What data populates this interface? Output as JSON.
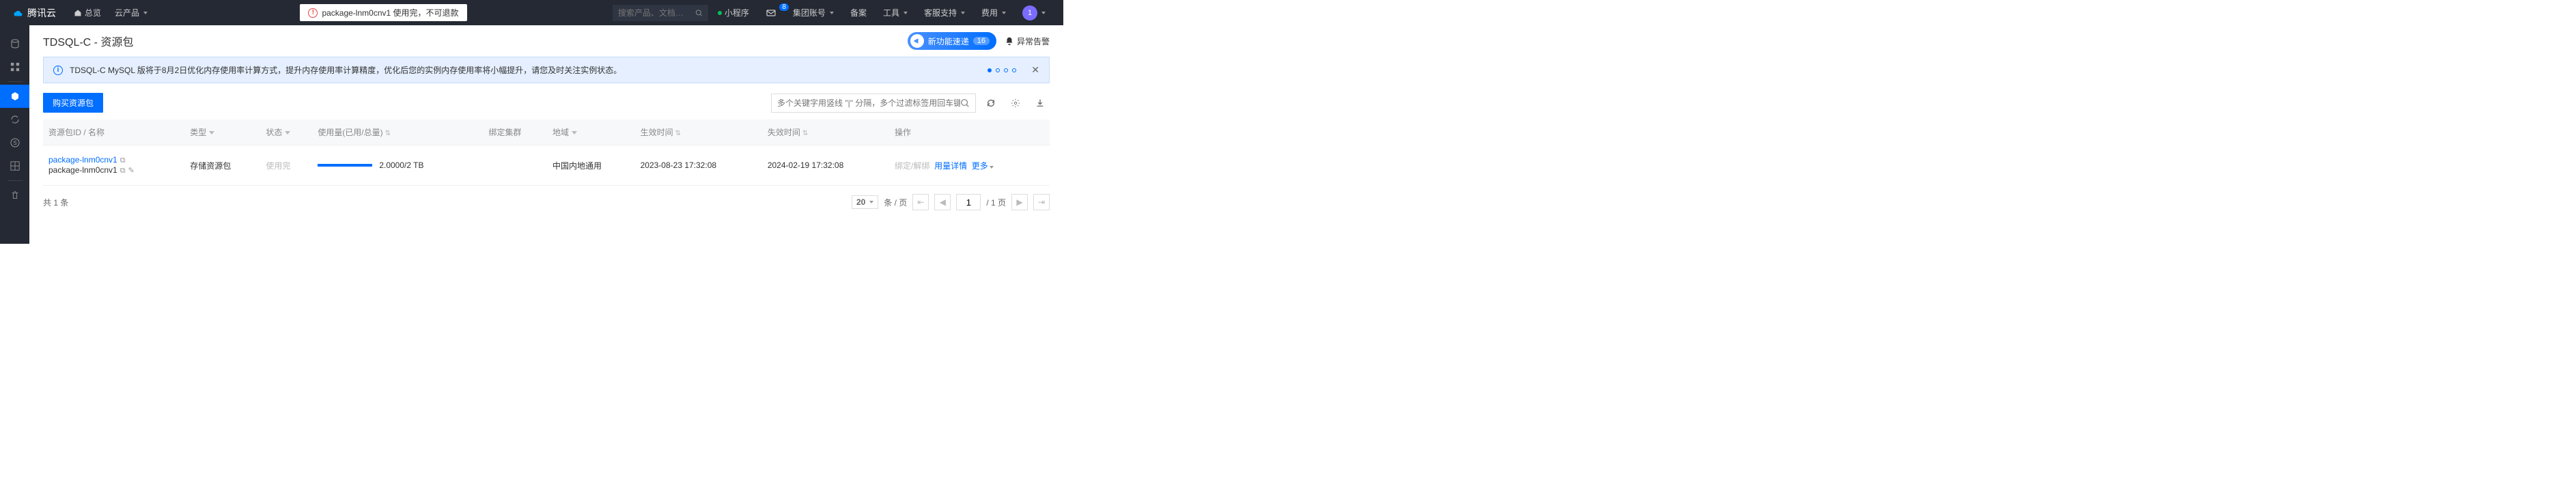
{
  "topbar": {
    "brand": "腾讯云",
    "overview": "总览",
    "products": "云产品",
    "alert_text": "package-lnm0cnv1 使用完，不可退款",
    "search_placeholder": "搜索产品、文档…",
    "mini_program": "小程序",
    "envelope_count": "8",
    "group_account": "集团账号",
    "beian": "备案",
    "tools": "工具",
    "support": "客服支持",
    "fees": "费用",
    "avatar_initial": "1"
  },
  "page": {
    "title": "TDSQL-C - 资源包",
    "new_feature": "新功能速递",
    "new_feature_count": "16",
    "alarm": "异常告警"
  },
  "banner": {
    "text": "TDSQL-C MySQL 版将于8月2日优化内存使用率计算方式，提升内存使用率计算精度，优化后您的实例内存使用率将小幅提升，请您及时关注实例状态。"
  },
  "toolbar": {
    "buy_button": "购买资源包",
    "filter_placeholder": "多个关键字用竖线 \"|\" 分隔，多个过滤标签用回车键分隔"
  },
  "columns": {
    "id_name": "资源包ID / 名称",
    "type": "类型",
    "status": "状态",
    "usage": "使用量(已用/总量)",
    "cluster": "绑定集群",
    "region": "地域",
    "effective": "生效时间",
    "expire": "失效时间",
    "action": "操作"
  },
  "row": {
    "id": "package-lnm0cnv1",
    "name": "package-lnm0cnv1",
    "type": "存储资源包",
    "status": "使用完",
    "usage": "2.0000/2 TB",
    "region": "中国内地通用",
    "effective": "2023-08-23 17:32:08",
    "expire": "2024-02-19 17:32:08",
    "action_bind": "绑定/解绑",
    "action_detail": "用量详情",
    "action_more": "更多"
  },
  "footer": {
    "total": "共 1 条",
    "page_size": "20",
    "page_size_suffix": "条 / 页",
    "page_total": "/ 1 页",
    "page_current": "1"
  }
}
